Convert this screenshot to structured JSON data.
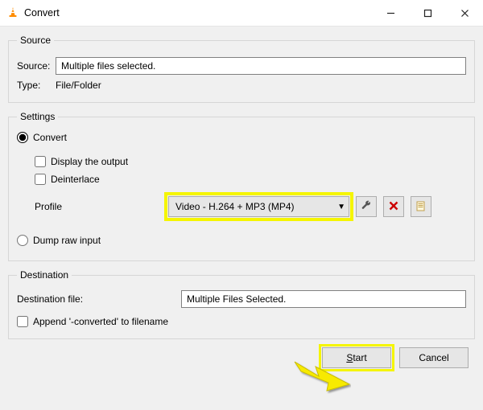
{
  "window": {
    "title": "Convert",
    "app_icon": "vlc-cone-icon"
  },
  "source_group": {
    "legend": "Source",
    "source_label": "Source:",
    "source_value": "Multiple files selected.",
    "type_label": "Type:",
    "type_value": "File/Folder"
  },
  "settings_group": {
    "legend": "Settings",
    "convert_radio": "Convert",
    "display_output_checkbox": "Display the output",
    "deinterlace_checkbox": "Deinterlace",
    "profile_label": "Profile",
    "profile_selected": "Video - H.264 + MP3 (MP4)",
    "tool_button": "wrench-icon",
    "delete_button": "delete-icon",
    "new_button": "new-profile-icon",
    "dump_radio": "Dump raw input"
  },
  "destination_group": {
    "legend": "Destination",
    "dest_file_label": "Destination file:",
    "dest_file_value": "Multiple Files Selected.",
    "append_checkbox": "Append '-converted' to filename"
  },
  "buttons": {
    "start_prefix": "S",
    "start_rest": "tart",
    "cancel": "Cancel"
  },
  "colors": {
    "highlight": "#f5f500"
  }
}
